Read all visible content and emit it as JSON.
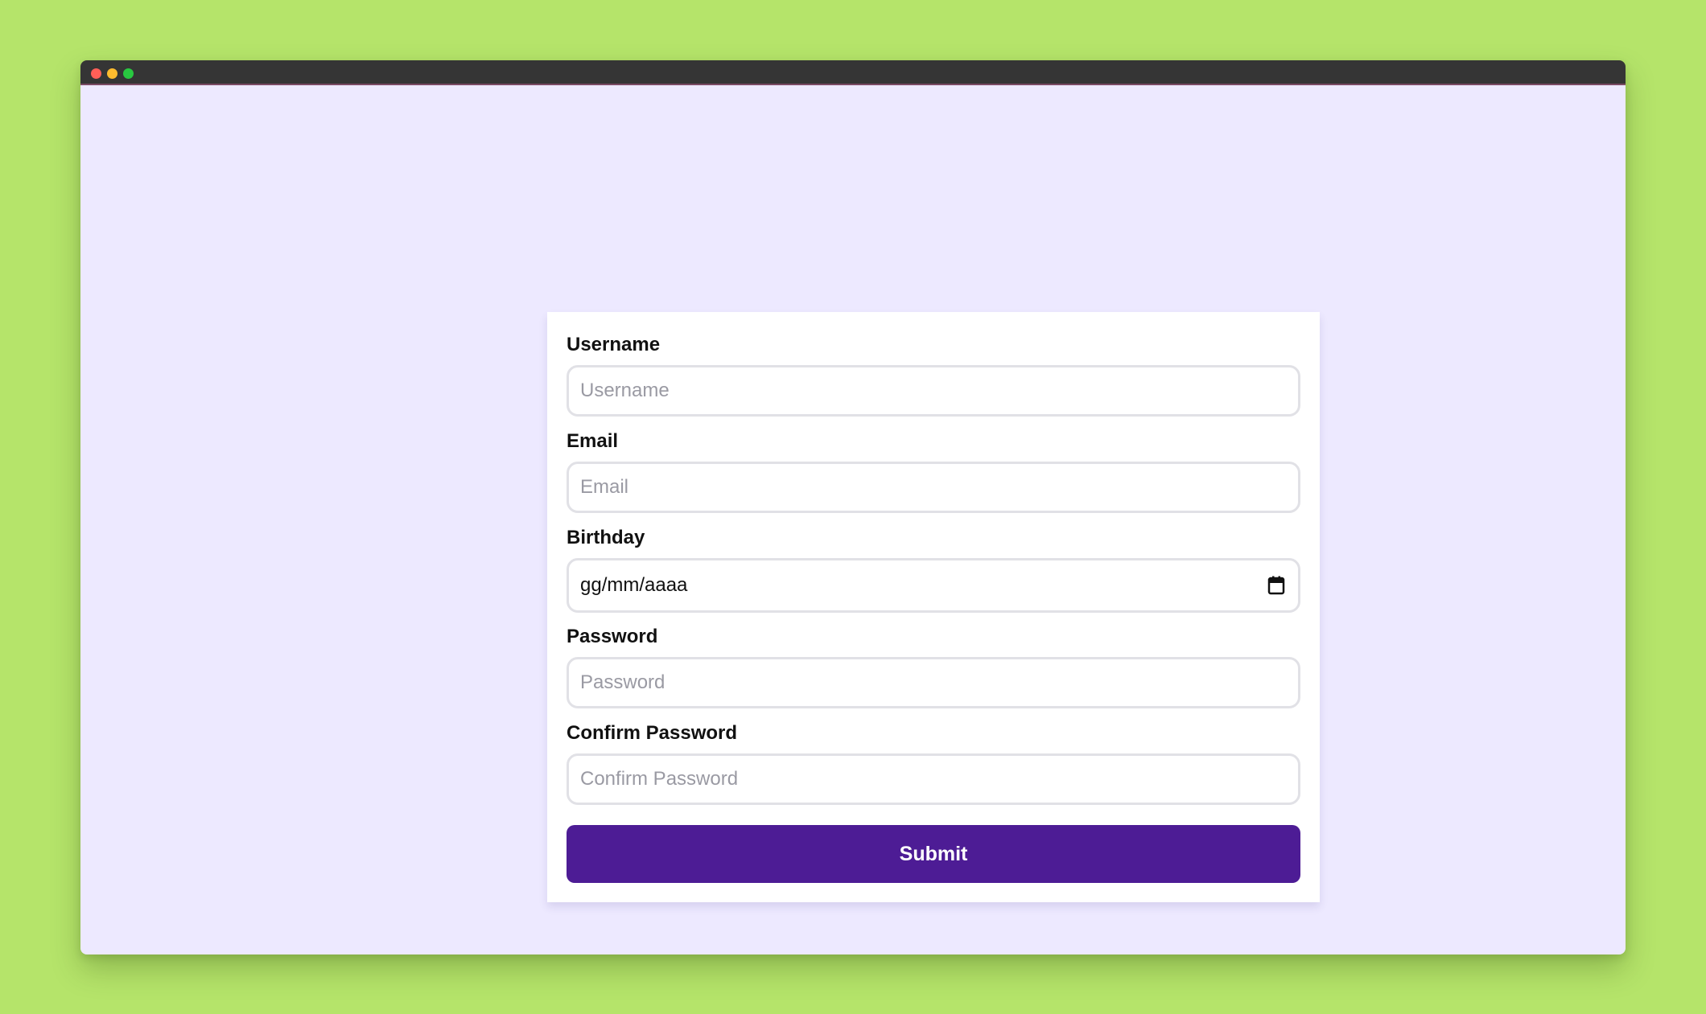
{
  "colors": {
    "backdrop": "#b5e46a",
    "titlebar": "#353535",
    "content_bg": "#ede9ff",
    "dot_red": "#ff5f57",
    "dot_yellow": "#febc2e",
    "dot_green": "#28c840",
    "button_bg": "#4d1c95"
  },
  "form": {
    "username": {
      "label": "Username",
      "placeholder": "Username",
      "value": ""
    },
    "email": {
      "label": "Email",
      "placeholder": "Email",
      "value": ""
    },
    "birthday": {
      "label": "Birthday",
      "display_value": "gg/mm/aaaa",
      "icon": "calendar-icon"
    },
    "password": {
      "label": "Password",
      "placeholder": "Password",
      "value": ""
    },
    "confirm_password": {
      "label": "Confirm Password",
      "placeholder": "Confirm Password",
      "value": ""
    },
    "submit_label": "Submit"
  }
}
